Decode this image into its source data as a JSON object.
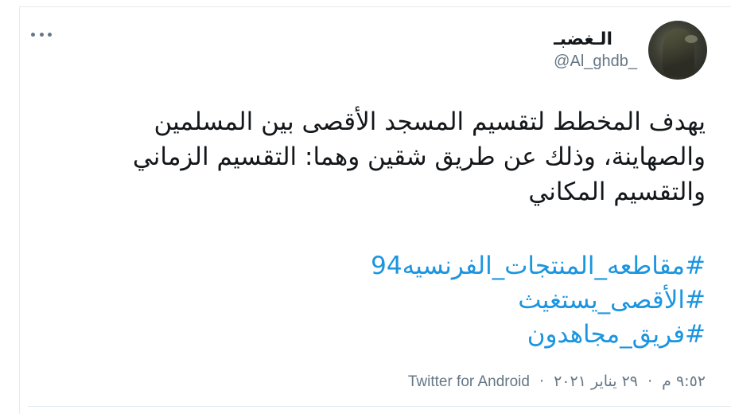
{
  "author": {
    "display_name": "الـغضبـ",
    "handle": "@Al_ghdb_",
    "avatar_icon": "profile-avatar"
  },
  "menu_icon": "more-horizontal-icon",
  "tweet": {
    "lines": [
      "يهدف المخطط لتقسيم المسجد الأقصى بين المسلمين",
      "والصهاينة، وذلك عن طريق شقين وهما: التقسيم الزماني",
      "والتقسيم المكاني"
    ],
    "hashtags": [
      "#مقاطعه_المنتجات_الفرنسيه94",
      "#الأقصى_يستغيث",
      "#فريق_مجاهدون"
    ]
  },
  "meta": {
    "time": "٩:٥٢ م",
    "date": "٢٩ يناير ٢٠٢١",
    "separator": "·",
    "source": "Twitter for Android"
  },
  "colors": {
    "link": "#1b95e0",
    "text": "#14171a",
    "secondary": "#657786",
    "border": "#e6ecf0"
  }
}
